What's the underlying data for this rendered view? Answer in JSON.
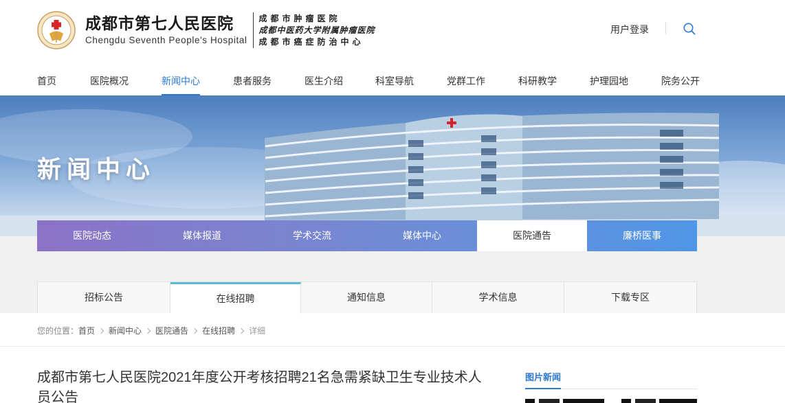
{
  "header": {
    "hospital_name_cn": "成都市第七人民医院",
    "hospital_name_en": "Chengdu Seventh People's Hospital",
    "sub_names": [
      "成都市肿瘤医院",
      "成都中医药大学附属肿瘤医院",
      "成都市癌症防治中心"
    ],
    "login_label": "用户登录",
    "search_icon": "search-icon",
    "logo_icon": "hospital-seal-logo"
  },
  "nav": {
    "items": [
      "首页",
      "医院概况",
      "新闻中心",
      "患者服务",
      "医生介绍",
      "科室导航",
      "党群工作",
      "科研教学",
      "护理园地",
      "院务公开"
    ],
    "active_index": 2
  },
  "banner": {
    "title": "新闻中心"
  },
  "categories": {
    "items": [
      "医院动态",
      "媒体报道",
      "学术交流",
      "媒体中心",
      "医院通告",
      "廉桥医事"
    ],
    "active_index": 4
  },
  "subtabs": {
    "items": [
      "招标公告",
      "在线招聘",
      "通知信息",
      "学术信息",
      "下载专区"
    ],
    "active_index": 1
  },
  "breadcrumb": {
    "prefix": "您的位置：",
    "items": [
      "首页",
      "新闻中心",
      "医院通告",
      "在线招聘"
    ],
    "current": "详细"
  },
  "article": {
    "title": "成都市第七人民医院2021年度公开考核招聘21名急需紧缺卫生专业技术人员公告"
  },
  "sidebar": {
    "title": "图片新闻"
  },
  "colors": {
    "accent": "#2c78d4",
    "subtab_accent": "#55b9d7",
    "category_gradient_start": "#8b72c6",
    "category_gradient_end": "#4f96e6"
  }
}
